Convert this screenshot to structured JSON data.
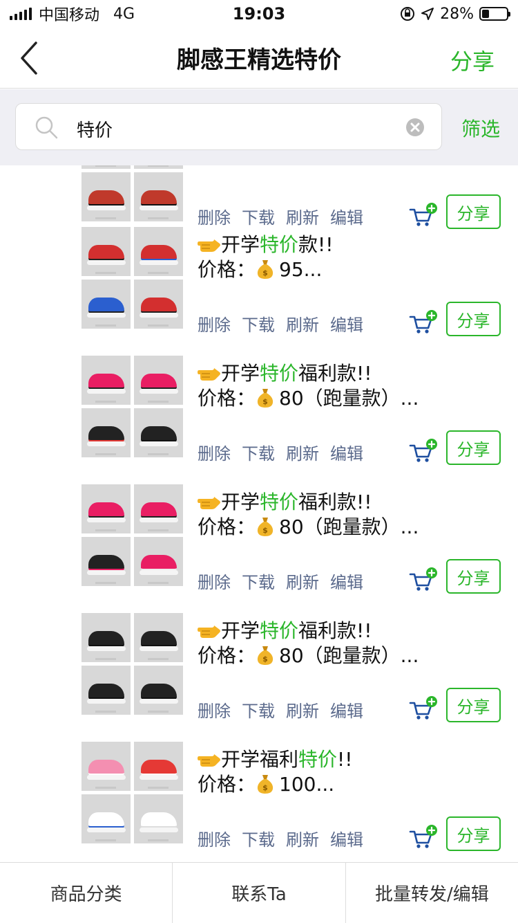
{
  "status": {
    "carrier": "中国移动",
    "network": "4G",
    "time": "19:03",
    "battery": "28%",
    "battery_level": 0.28
  },
  "nav": {
    "title": "脚感王精选特价",
    "share": "分享"
  },
  "search": {
    "value": "特价",
    "filter": "筛选"
  },
  "actions": {
    "delete": "删除",
    "download": "下载",
    "refresh": "刷新",
    "edit": "编辑",
    "share": "分享"
  },
  "items": [
    {
      "title_a": "",
      "title_hl": "",
      "title_b": "",
      "price_label": "",
      "price_value": ""
    },
    {
      "title_a": "开学",
      "title_hl": "特价",
      "title_b": "款!!",
      "price_label": "价格：",
      "price_value": "95..."
    },
    {
      "title_a": "开学",
      "title_hl": "特价",
      "title_b": "福利款!!",
      "price_label": "价格：",
      "price_value": "80（跑量款）..."
    },
    {
      "title_a": "开学",
      "title_hl": "特价",
      "title_b": "福利款!!",
      "price_label": "价格：",
      "price_value": "80（跑量款）..."
    },
    {
      "title_a": "开学",
      "title_hl": "特价",
      "title_b": "福利款!!",
      "price_label": "价格：",
      "price_value": "80（跑量款）..."
    },
    {
      "title_a": "开学福利",
      "title_hl": "特价",
      "title_b": "!!",
      "price_label": "价格：",
      "price_value": "100..."
    }
  ],
  "bottom_tabs": [
    "商品分类",
    "联系Ta",
    "批量转发/编辑"
  ],
  "colors": {
    "accent": "#2bb62b",
    "action_text": "#5b6a8c",
    "cart": "#1e4fa0"
  },
  "icons": [
    "back-chevron-icon",
    "search-icon",
    "clear-icon",
    "pointing-hand-icon",
    "money-bag-icon",
    "add-to-cart-icon"
  ]
}
